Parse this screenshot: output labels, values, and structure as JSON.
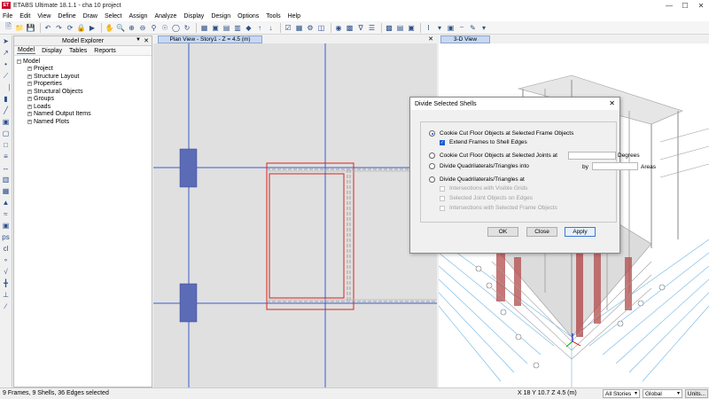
{
  "window": {
    "title": "ETABS Ultimate 18.1.1 - cha 10 project",
    "logo": "ET"
  },
  "menu": [
    "File",
    "Edit",
    "View",
    "Define",
    "Draw",
    "Select",
    "Assign",
    "Analyze",
    "Display",
    "Design",
    "Options",
    "Tools",
    "Help"
  ],
  "explorer": {
    "title": "Model Explorer",
    "tabs": [
      "Model",
      "Display",
      "Tables",
      "Reports"
    ],
    "root": "Model",
    "items": [
      "Project",
      "Structure Layout",
      "Properties",
      "Structural Objects",
      "Groups",
      "Loads",
      "Named Output Items",
      "Named Plots"
    ]
  },
  "plan_view": {
    "tab": "Plan View - Story1 - Z = 4.5 (m)"
  },
  "view3d": {
    "tab": "3-D View"
  },
  "dialog": {
    "title": "Divide Selected Shells",
    "opt_cookie_frames": "Cookie Cut Floor Objects at Selected Frame Objects",
    "chk_extend": "Extend Frames to Shell Edges",
    "opt_cookie_joints": "Cookie Cut Floor Objects at Selected Joints at",
    "degrees_label": "Degrees",
    "by_label": "by",
    "areas_label": "Areas",
    "opt_divide_into": "Divide Quadrilaterals/Triangles into",
    "opt_divide_at": "Divide Quadrilaterals/Triangles at",
    "chk_grids": "Intersections with Visible Grids",
    "chk_joints": "Selected Joint Objects on Edges",
    "chk_frames": "Intersections with Selected Frame Objects",
    "ok": "OK",
    "close": "Close",
    "apply": "Apply"
  },
  "status": {
    "selection": "9 Frames, 9 Shells, 36 Edges selected",
    "coords": "X 18  Y 10.7  Z 4.5 (m)",
    "stories": "All Stories",
    "system": "Global",
    "units": "Units..."
  }
}
